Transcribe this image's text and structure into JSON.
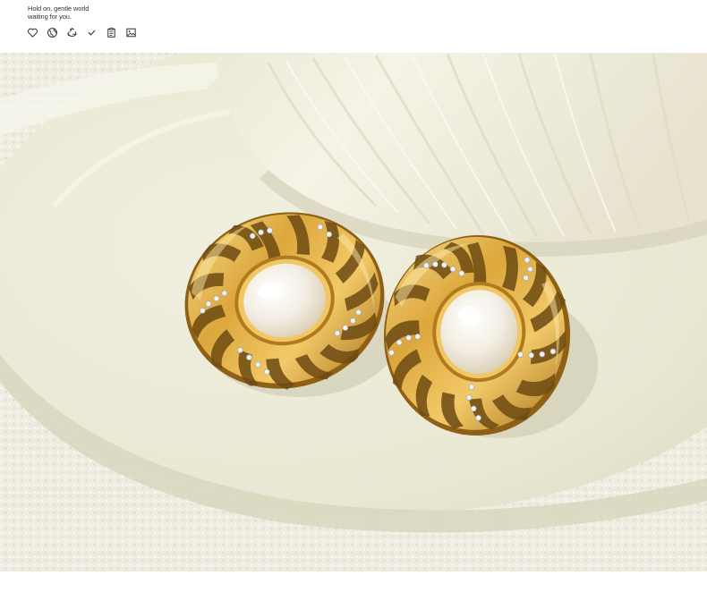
{
  "header": {
    "tagline_line1": "Hold on, gentle world",
    "tagline_line2": "waiting for you."
  },
  "icons": [
    {
      "name": "heart-icon"
    },
    {
      "name": "globe-icon"
    },
    {
      "name": "recycle-icon"
    },
    {
      "name": "check-icon"
    },
    {
      "name": "clipboard-icon"
    },
    {
      "name": "image-icon"
    }
  ],
  "colors": {
    "gold": "#d9a53a",
    "gold_light": "#f4d27c",
    "gold_dark": "#9b6a16",
    "pearl": "#f6f1e6",
    "plate": "#ecebd6",
    "cloth": "#f1ede2"
  }
}
